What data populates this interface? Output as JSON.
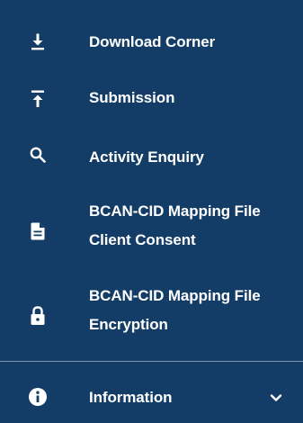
{
  "sidebar": {
    "items": [
      {
        "label": "Download Corner",
        "icon": "download-icon"
      },
      {
        "label": "Submission",
        "icon": "upload-icon"
      },
      {
        "label": "Activity Enquiry",
        "icon": "search-icon"
      },
      {
        "label_line1": "BCAN-CID Mapping File",
        "label_line2": "Client Consent",
        "icon": "document-icon"
      },
      {
        "label_line1": "BCAN-CID Mapping File",
        "label_line2": "Encryption",
        "icon": "lock-icon"
      }
    ],
    "footer": {
      "label": "Information",
      "icon": "info-icon",
      "toggle_icon": "chevron-down-icon"
    }
  },
  "colors": {
    "background": "#133d67",
    "text": "#ffffff",
    "divider": "#7b93ad"
  }
}
